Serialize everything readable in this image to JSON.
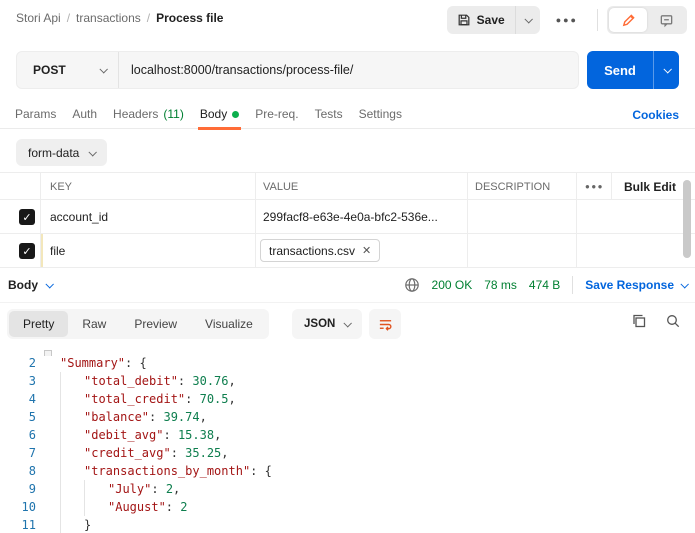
{
  "accent": {
    "orange": "#ff6c37",
    "blue": "#0265dd",
    "green": "#007f31",
    "dot_green": "#0caf4d"
  },
  "breadcrumb": {
    "item1": "Stori Api",
    "item2": "transactions",
    "item3": "Process file",
    "separator": "/"
  },
  "topbar": {
    "save_label": "Save"
  },
  "request": {
    "method": "POST",
    "url": "localhost:8000/transactions/process-file/",
    "send_label": "Send"
  },
  "request_tabs": {
    "params": "Params",
    "auth": "Auth",
    "headers": "Headers",
    "headers_count": "(11)",
    "body": "Body",
    "prereq": "Pre-req.",
    "tests": "Tests",
    "settings": "Settings",
    "cookies": "Cookies"
  },
  "body_section": {
    "type_selector": "form-data"
  },
  "table": {
    "headers": {
      "key": "KEY",
      "value": "VALUE",
      "description": "DESCRIPTION",
      "bulk_edit": "Bulk Edit"
    },
    "rows": [
      {
        "key": "account_id",
        "value": "299facf8-e63e-4e0a-bfc2-536e...",
        "checked": true
      },
      {
        "key": "file",
        "file_chip": "transactions.csv",
        "checked": true
      }
    ]
  },
  "response": {
    "body_label": "Body",
    "status": "200 OK",
    "time": "78 ms",
    "size": "474 B",
    "save_label": "Save Response",
    "view_tabs": {
      "pretty": "Pretty",
      "raw": "Raw",
      "preview": "Preview",
      "visualize": "Visualize"
    },
    "format": "JSON"
  },
  "code": {
    "lines": [
      {
        "num": 2,
        "indent": 1,
        "tokens": [
          {
            "t": "\"Summary\"",
            "c": "k"
          },
          {
            "t": ": {",
            "c": "p"
          }
        ]
      },
      {
        "num": 3,
        "indent": 2,
        "tokens": [
          {
            "t": "\"total_debit\"",
            "c": "k"
          },
          {
            "t": ": ",
            "c": "p"
          },
          {
            "t": "30.76",
            "c": "n"
          },
          {
            "t": ",",
            "c": "p"
          }
        ]
      },
      {
        "num": 4,
        "indent": 2,
        "tokens": [
          {
            "t": "\"total_credit\"",
            "c": "k"
          },
          {
            "t": ": ",
            "c": "p"
          },
          {
            "t": "70.5",
            "c": "n"
          },
          {
            "t": ",",
            "c": "p"
          }
        ]
      },
      {
        "num": 5,
        "indent": 2,
        "tokens": [
          {
            "t": "\"balance\"",
            "c": "k"
          },
          {
            "t": ": ",
            "c": "p"
          },
          {
            "t": "39.74",
            "c": "n"
          },
          {
            "t": ",",
            "c": "p"
          }
        ]
      },
      {
        "num": 6,
        "indent": 2,
        "tokens": [
          {
            "t": "\"debit_avg\"",
            "c": "k"
          },
          {
            "t": ": ",
            "c": "p"
          },
          {
            "t": "15.38",
            "c": "n"
          },
          {
            "t": ",",
            "c": "p"
          }
        ]
      },
      {
        "num": 7,
        "indent": 2,
        "tokens": [
          {
            "t": "\"credit_avg\"",
            "c": "k"
          },
          {
            "t": ": ",
            "c": "p"
          },
          {
            "t": "35.25",
            "c": "n"
          },
          {
            "t": ",",
            "c": "p"
          }
        ]
      },
      {
        "num": 8,
        "indent": 2,
        "tokens": [
          {
            "t": "\"transactions_by_month\"",
            "c": "k"
          },
          {
            "t": ": {",
            "c": "p"
          }
        ]
      },
      {
        "num": 9,
        "indent": 3,
        "tokens": [
          {
            "t": "\"July\"",
            "c": "k"
          },
          {
            "t": ": ",
            "c": "p"
          },
          {
            "t": "2",
            "c": "n"
          },
          {
            "t": ",",
            "c": "p"
          }
        ]
      },
      {
        "num": 10,
        "indent": 3,
        "tokens": [
          {
            "t": "\"August\"",
            "c": "k"
          },
          {
            "t": ": ",
            "c": "p"
          },
          {
            "t": "2",
            "c": "n"
          }
        ]
      },
      {
        "num": 11,
        "indent": 2,
        "tokens": [
          {
            "t": "}",
            "c": "p"
          }
        ]
      }
    ]
  }
}
